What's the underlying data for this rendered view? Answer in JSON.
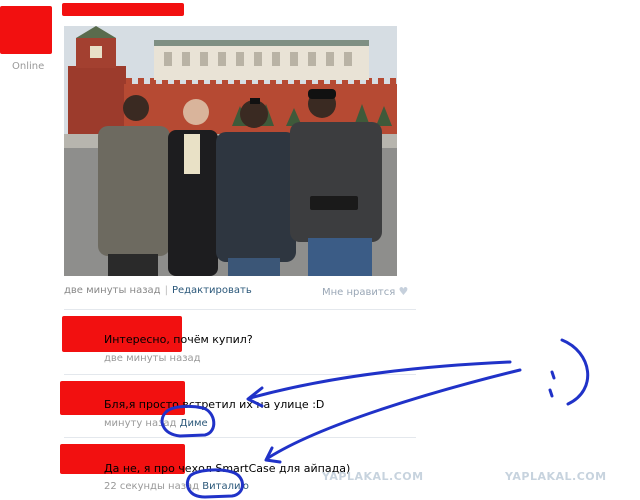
{
  "profile": {
    "status": "Online"
  },
  "post": {
    "time": "две минуты назад",
    "separator": "|",
    "edit_label": "Редактировать",
    "like_label": "Мне нравится"
  },
  "comments": [
    {
      "text": "Интересно, почём купил?",
      "time": "две минуты назад",
      "reply_to": ""
    },
    {
      "text": "Бля,я просто встретил их на улице :D",
      "time": "минуту назад",
      "reply_to": "Диме"
    },
    {
      "text": "Да не, я про чехол SmartCase для айпада)",
      "time": "22 секунды назад",
      "reply_to": "Виталию"
    }
  ],
  "annotation": {
    "smiley": ":)"
  },
  "watermarks": [
    "YAPLAKAL.COM",
    "YAPLAKAL.COM"
  ],
  "colors": {
    "redaction": "#f21010",
    "annotation_ink": "#2032c8",
    "link": "#2b587a",
    "muted_text": "#999999"
  },
  "icons": {
    "like": "heart-icon"
  }
}
